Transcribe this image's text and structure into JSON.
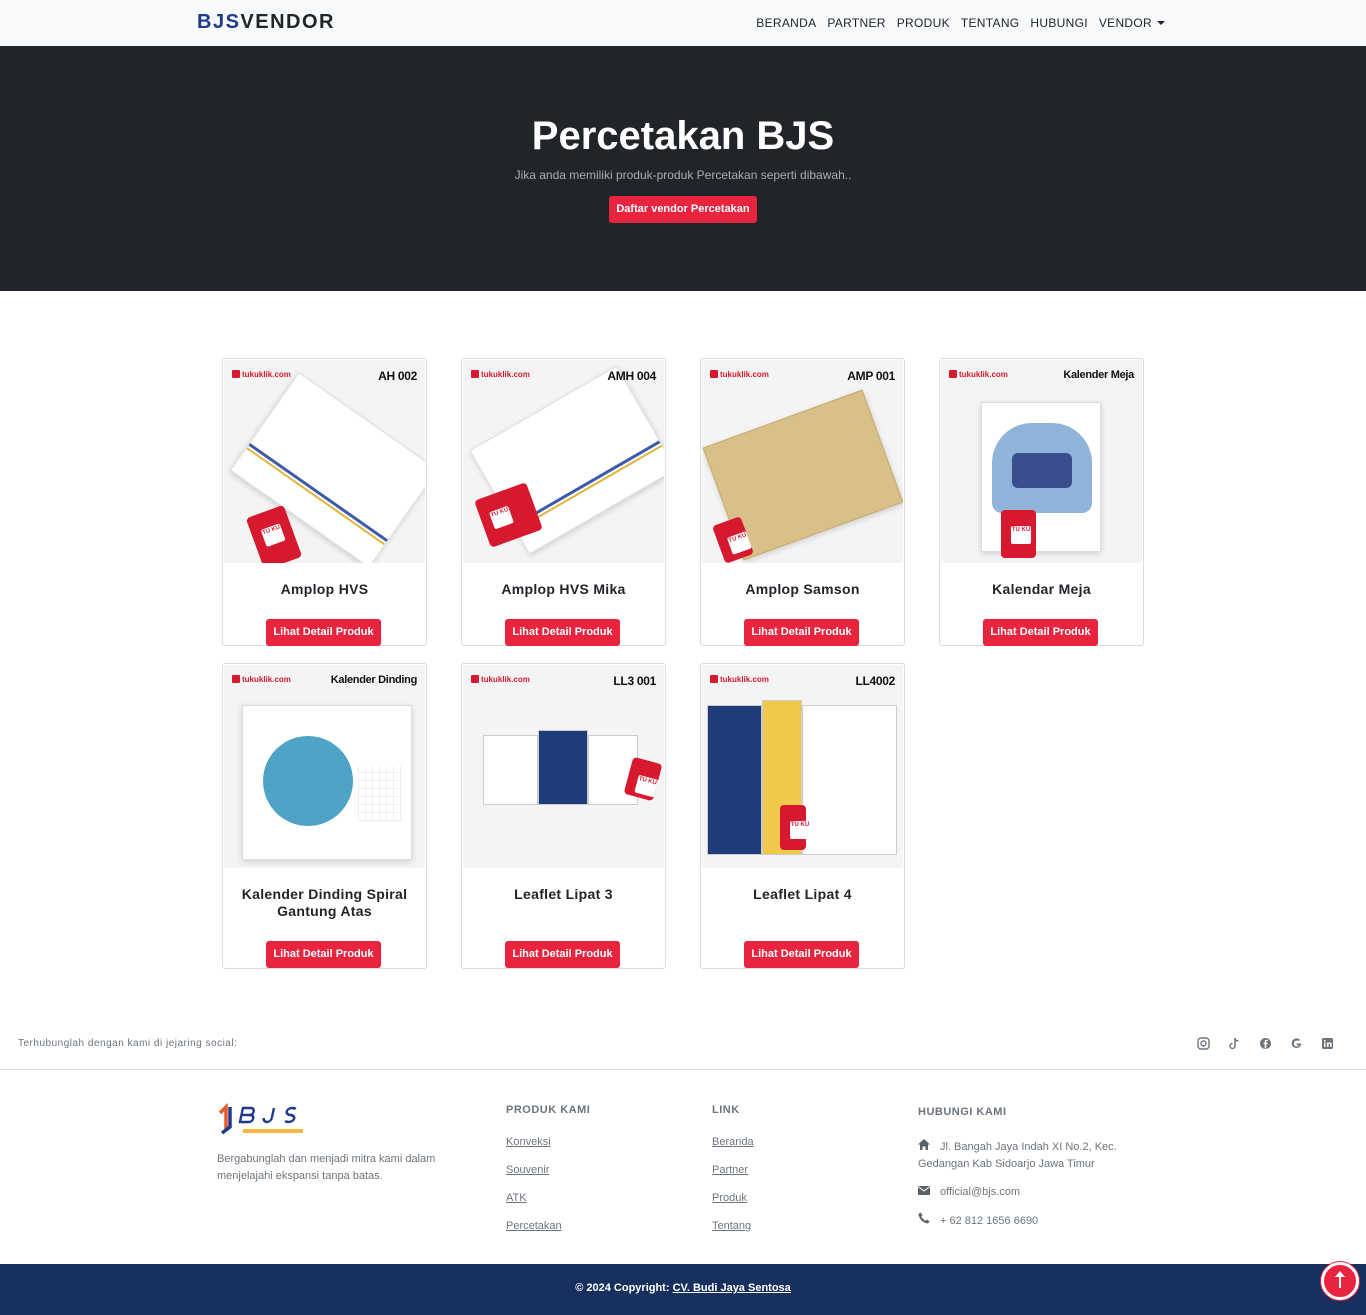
{
  "navbar": {
    "brand_part1": "BJS",
    "brand_part2": "VENDOR",
    "links": [
      "BERANDA",
      "PARTNER",
      "PRODUK",
      "TENTANG",
      "HUBUNGI",
      "VENDOR"
    ]
  },
  "hero": {
    "title": "Percetakan BJS",
    "subtitle": "Jika anda memiliki produk-produk Percetakan seperti dibawah..",
    "cta": "Daftar vendor Percetakan"
  },
  "products": [
    {
      "name": "Amplop HVS",
      "code": "AH 002",
      "button": "Lihat Detail Produk"
    },
    {
      "name": "Amplop HVS Mika",
      "code": "AMH 004",
      "button": "Lihat Detail Produk"
    },
    {
      "name": "Amplop Samson",
      "code": "AMP 001",
      "button": "Lihat Detail Produk"
    },
    {
      "name": "Kalendar Meja",
      "code": "Kalender Meja",
      "button": "Lihat Detail Produk"
    },
    {
      "name": "Kalender Dinding Spiral Gantung Atas",
      "code": "Kalender Dinding",
      "button": "Lihat Detail Produk"
    },
    {
      "name": "Leaflet Lipat 3",
      "code": "LL3 001",
      "button": "Lihat Detail Produk"
    },
    {
      "name": "Leaflet Lipat 4",
      "code": "LL4002",
      "button": "Lihat Detail Produk"
    }
  ],
  "image_brand": "tukuklik.com",
  "social": {
    "text": "Terhubunglah dengan kami di jejaring social:",
    "icons": [
      "instagram-icon",
      "tiktok-icon",
      "facebook-icon",
      "google-icon",
      "linkedin-icon"
    ]
  },
  "footer": {
    "description": "Bergabunglah dan menjadi mitra kami dalam menjelajahi ekspansi tanpa batas.",
    "products_title": "PRODUK KAMI",
    "products_links": [
      "Konveksi",
      "Souvenir",
      "ATK",
      "Percetakan"
    ],
    "link_title": "LINK",
    "link_links": [
      "Beranda",
      "Partner",
      "Produk",
      "Tentang"
    ],
    "contact_title": "HUBUNGI KAMI",
    "address": "Jl. Bangah Jaya Indah XI No.2, Kec. Gedangan Kab Sidoarjo Jawa Timur",
    "email": "official@bjs.com",
    "phone": "+ 62 812 1656 6690"
  },
  "copyright": {
    "prefix": "© 2024 Copyright:",
    "company": "CV. Budi Jaya Sentosa"
  },
  "colors": {
    "accent": "#e8243f",
    "hero_bg": "#212529",
    "footer_bar": "#17305d",
    "brand_blue": "#1e3a8a"
  }
}
